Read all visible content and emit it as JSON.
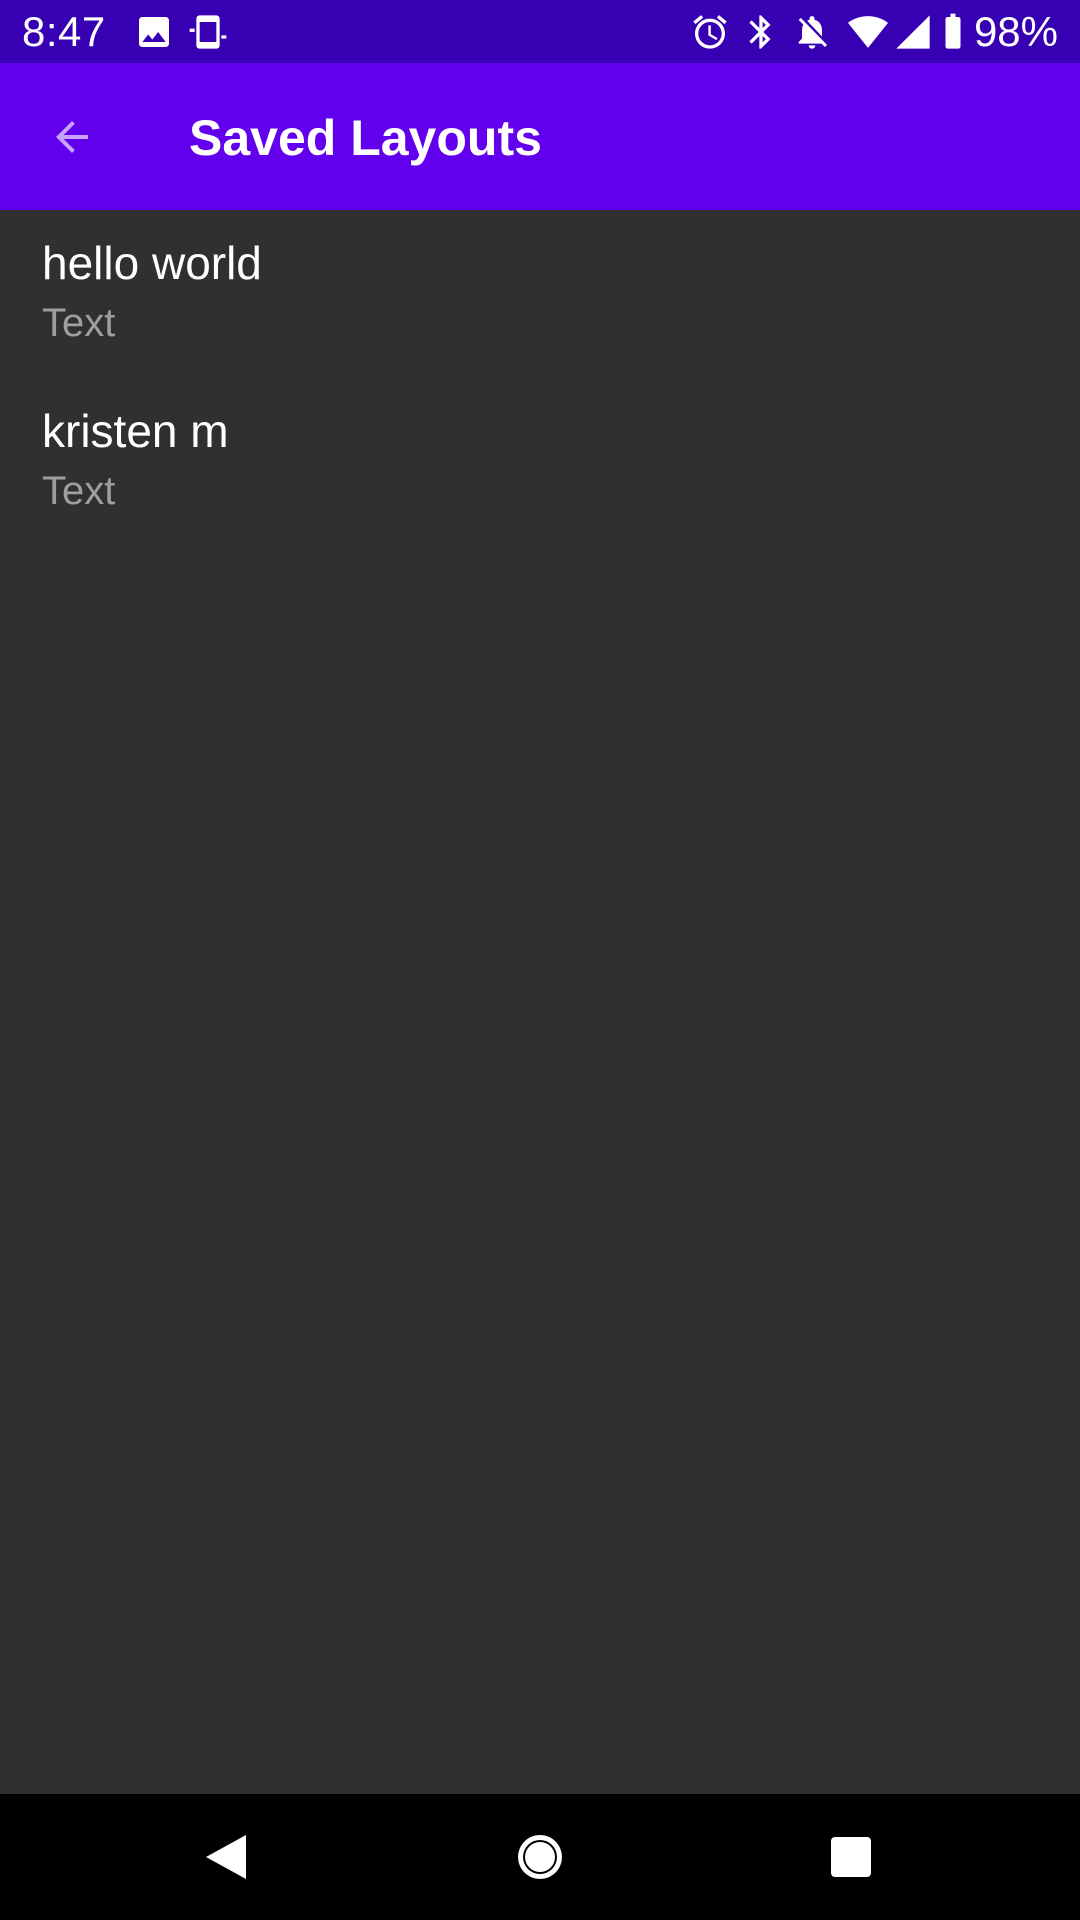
{
  "status_bar": {
    "time": "8:47",
    "battery": "98%",
    "icons": [
      "image-icon",
      "device-icon",
      "alarm-icon",
      "bluetooth-icon",
      "notifications-off-icon",
      "wifi-icon",
      "signal-icon",
      "battery-icon"
    ]
  },
  "app_bar": {
    "title": "Saved Layouts",
    "back_icon": "arrow-back-icon"
  },
  "saved_layouts": [
    {
      "title": "hello world",
      "subtitle": "Text"
    },
    {
      "title": "kristen m",
      "subtitle": "Text"
    }
  ],
  "nav_bar": {
    "buttons": [
      "back-triangle-icon",
      "home-circle-icon",
      "recents-square-icon"
    ]
  },
  "colors": {
    "status_bar": "#3700B3",
    "app_bar": "#6200EE",
    "background": "#303030",
    "nav_bar": "#000000",
    "subtitle_text": "#9E9E9E"
  }
}
